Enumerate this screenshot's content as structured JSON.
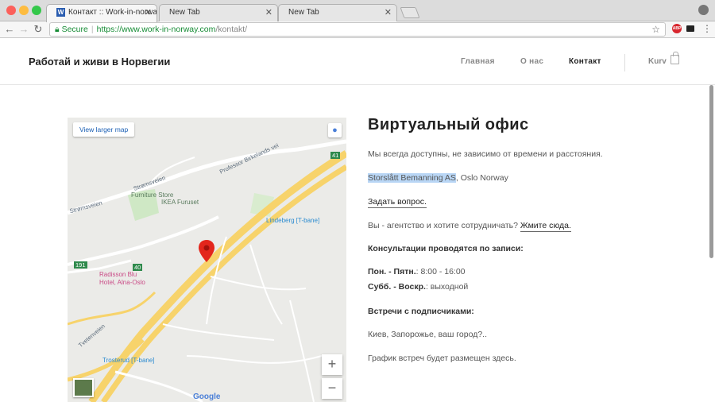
{
  "browser": {
    "tabs": [
      {
        "title": "Контакт :: Work-in-norway-co",
        "favicon": "W"
      },
      {
        "title": "New Tab"
      },
      {
        "title": "New Tab"
      }
    ],
    "address": {
      "secure_label": "Secure",
      "url_host": "https://www.work-in-norway.com",
      "url_path": "/kontakt/"
    },
    "extension_badge": "ABP"
  },
  "site": {
    "brand": "Работай и живи в Норвегии",
    "nav": [
      "Главная",
      "О нас",
      "Контакт"
    ],
    "cart_label": "Kurv"
  },
  "map": {
    "larger_map": "View larger map",
    "labels": {
      "furniture": "Furniture Store",
      "ikea": "IKEA Furuset",
      "lindeberg": "Lindeberg [T-bane]",
      "radisson": "Radisson Blu",
      "hotel": "Hotel, Alna-Oslo",
      "trosterud": "Trosterud [T-bane]",
      "stromsveien": "Strømsveien",
      "stromsveien2": "Strømsveien",
      "professor": "Professor Birkelands vei",
      "tvetenveien": "Tvetenveien",
      "r191": "191",
      "r40": "40",
      "r41": "41",
      "google": "Google"
    },
    "zoom_in": "+",
    "zoom_out": "−"
  },
  "content": {
    "title": "Виртуальный офис",
    "line1": "Мы всегда доступны, не зависимо от времени и расстояния.",
    "company": "Storslått Bemanning AS",
    "company_rest": ", Oslo Norway",
    "ask": "Задать вопрос.",
    "agency": "Вы - агентство и хотите сотрудничать? ",
    "agency_link": "Жмите сюда.",
    "consult": "Консультации проводятся по записи:",
    "weekdays_label": "Пон. - Пятн.",
    "weekdays_value": ": 8:00 - 16:00",
    "weekend_label": "Субб. - Воскр.",
    "weekend_value": ":  выходной",
    "meet": "Встречи с подписчиками:",
    "cities": "Киев, Запорожье, ваш город?..",
    "schedule": "График встреч будет размещен здесь."
  }
}
